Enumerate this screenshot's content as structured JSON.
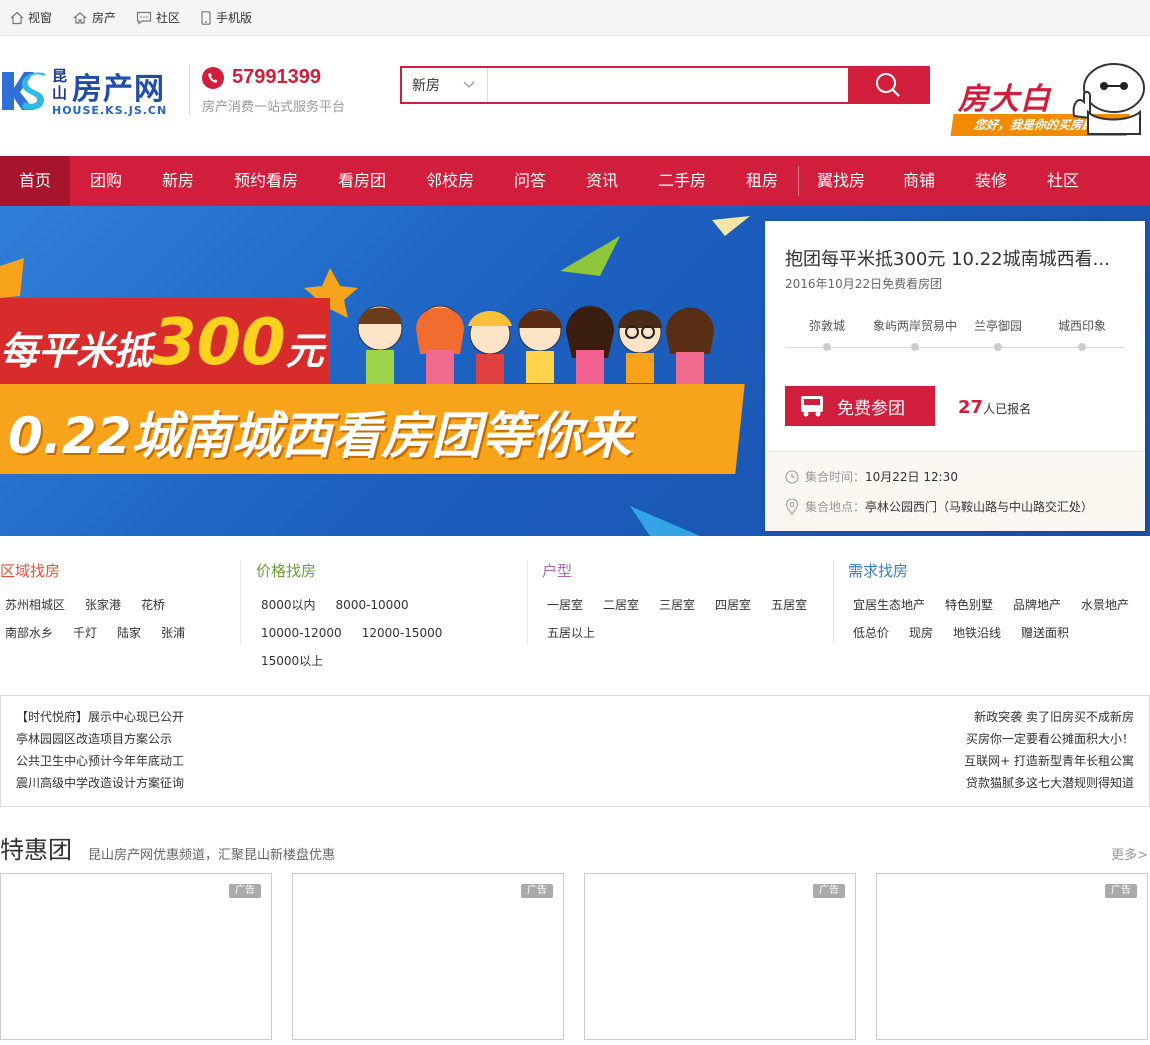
{
  "topbar": {
    "items": [
      {
        "label": "视窗",
        "icon": "home-icon"
      },
      {
        "label": "房产",
        "icon": "house-icon"
      },
      {
        "label": "社区",
        "icon": "chat-icon"
      },
      {
        "label": "手机版",
        "icon": "mobile-icon"
      }
    ]
  },
  "header": {
    "logo_small": "昆山",
    "logo_big": "房产网",
    "logo_domain": "HOUSE.KS.JS.CN",
    "phone": "57991399",
    "slogan": "房产消费一站式服务平台",
    "search_type": "新房",
    "search_placeholder": "",
    "badge_title": "房大白",
    "badge_sub": "您好，我是你的买房顾问"
  },
  "nav": {
    "items": [
      "首页",
      "团购",
      "新房",
      "预约看房",
      "看房团",
      "邻校房",
      "问答",
      "资讯",
      "二手房",
      "租房",
      "翼找房",
      "商铺",
      "装修",
      "社区"
    ]
  },
  "banner": {
    "line1_prefix": "每平米抵",
    "line1_amount": "300",
    "line1_suffix": "元",
    "line2": "0.22城南城西看房团等你来"
  },
  "panel": {
    "title": "抱团每平米抵300元 10.22城南城西看...",
    "date": "2016年10月22日免费看房团",
    "stops": [
      "弥敦城",
      "象屿两岸贸易中",
      "兰亭御园",
      "城西印象"
    ],
    "join_label": "免费参团",
    "count": "27",
    "count_suffix": "人已报名",
    "time_label": "集合时间：",
    "time_value": "10月22日 12:30",
    "place_label": "集合地点：",
    "place_value": "亭林公园西门（马鞍山路与中山路交汇处）"
  },
  "find": {
    "area": {
      "title": "区域找房",
      "color": "#e0533a",
      "tags": [
        "苏州相城区",
        "张家港",
        "花桥",
        "南部水乡",
        "千灯",
        "陆家",
        "张浦"
      ]
    },
    "price": {
      "title": "价格找房",
      "color": "#6aa13a",
      "tags": [
        "8000以内",
        "8000-10000",
        "10000-12000",
        "12000-15000",
        "15000以上"
      ]
    },
    "layout": {
      "title": "户型",
      "color": "#b163b8",
      "tags": [
        "一居室",
        "二居室",
        "三居室",
        "四居室",
        "五居室",
        "五居以上"
      ]
    },
    "need": {
      "title": "需求找房",
      "color": "#3a7cc6",
      "tags": [
        "宜居生态地产",
        "特色别墅",
        "品牌地产",
        "水景地产",
        "低总价",
        "现房",
        "地铁沿线",
        "赠送面积"
      ]
    }
  },
  "news": {
    "left": [
      "【时代悦府】展示中心现已公开",
      "亭林园园区改造项目方案公示",
      "公共卫生中心预计今年年底动工",
      "震川高级中学改造设计方案征询"
    ],
    "right": [
      "新政突袭 卖了旧房买不成新房",
      "买房你一定要看公摊面积大小！",
      "互联网+ 打造新型青年长租公寓",
      "贷款猫腻多这七大潜规则得知道"
    ]
  },
  "tehui": {
    "title": "特惠团",
    "desc": "昆山房产网优惠频道，汇聚昆山新楼盘优惠",
    "more": "更多>",
    "ad_label": "广告"
  },
  "colors": {
    "brand_red": "#d01e3c",
    "nav_active": "#a8142d"
  }
}
